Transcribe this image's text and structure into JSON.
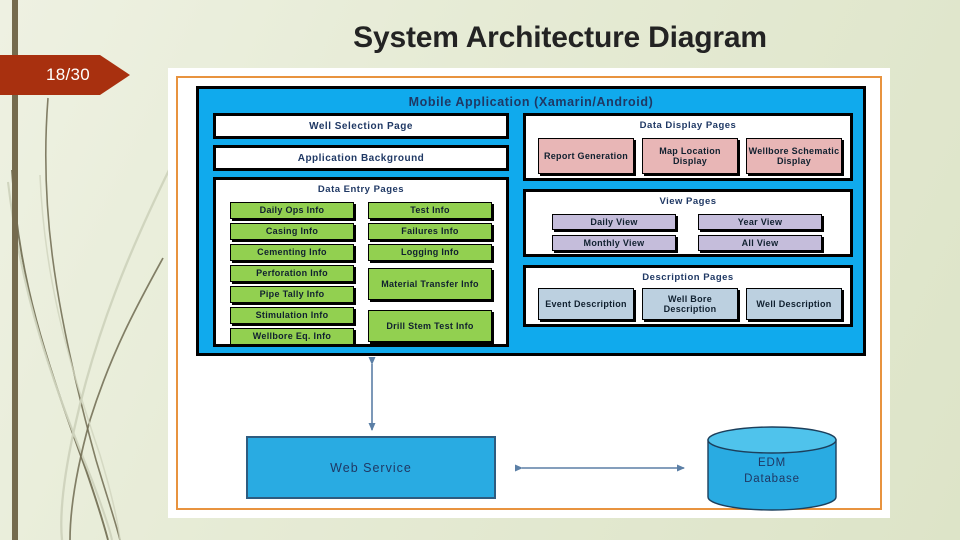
{
  "slide": {
    "title": "System Architecture Diagram",
    "page_indicator": "18/30"
  },
  "theme": {
    "background_start": "#eef1e2",
    "background_end": "#dde4c8",
    "olive_bar": "#756b4e",
    "badge_red": "#a8300f",
    "panel_border_orange": "#e8933f",
    "container_blue": "#10aaed",
    "node_cyan": "#29abe2",
    "green_box": "#92d050",
    "pink_box": "#e8b6b6",
    "violet_box": "#c5bddb",
    "steel_box": "#bcd0e0",
    "text_navy": "#1f3864",
    "arrow_color": "#5b7fa6"
  },
  "diagram": {
    "mobile_app": {
      "title": "Mobile Application (Xamarin/Android)",
      "top_bars": [
        {
          "label": "Well Selection Page"
        },
        {
          "label": "Application Background"
        }
      ],
      "data_entry": {
        "title": "Data Entry Pages",
        "left_column": [
          {
            "label": "Daily Ops Info"
          },
          {
            "label": "Casing Info"
          },
          {
            "label": "Cementing Info"
          },
          {
            "label": "Perforation Info"
          },
          {
            "label": "Pipe Tally Info"
          },
          {
            "label": "Stimulation Info"
          },
          {
            "label": "Wellbore Eq. Info"
          }
        ],
        "right_column": [
          {
            "label": "Test Info"
          },
          {
            "label": "Failures Info"
          },
          {
            "label": "Logging Info"
          },
          {
            "label": "Material Transfer Info"
          },
          {
            "label": "Drill Stem Test Info"
          }
        ]
      },
      "data_display": {
        "title": "Data Display Pages",
        "items": [
          {
            "label": "Report Generation"
          },
          {
            "label": "Map Location Display"
          },
          {
            "label": "Wellbore Schematic Display"
          }
        ]
      },
      "view_pages": {
        "title": "View Pages",
        "items": [
          {
            "label": "Daily View"
          },
          {
            "label": "Year View"
          },
          {
            "label": "Monthly View"
          },
          {
            "label": "All View"
          }
        ]
      },
      "description_pages": {
        "title": "Description Pages",
        "items": [
          {
            "label": "Event Description"
          },
          {
            "label": "Well Bore Description"
          },
          {
            "label": "Well Description"
          }
        ]
      }
    },
    "web_service": {
      "label": "Web Service"
    },
    "database": {
      "label": "EDM\nDatabase",
      "line1": "EDM",
      "line2": "Database"
    }
  }
}
